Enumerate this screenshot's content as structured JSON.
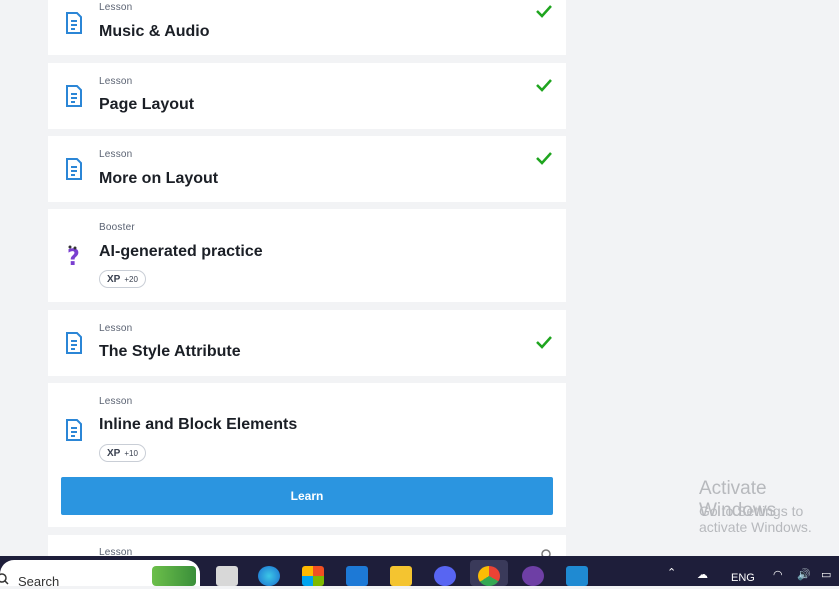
{
  "cards": [
    {
      "type": "Lesson",
      "title": "Music & Audio",
      "completed": true
    },
    {
      "type": "Lesson",
      "title": "Page Layout",
      "completed": true
    },
    {
      "type": "Lesson",
      "title": "More on Layout",
      "completed": true
    },
    {
      "type": "Booster",
      "title": "AI-generated practice",
      "xp_label": "XP",
      "xp_amount": "+20",
      "completed": false
    },
    {
      "type": "Lesson",
      "title": "The Style Attribute",
      "completed": true
    },
    {
      "type": "Lesson",
      "title": "Inline and Block Elements",
      "xp_label": "XP",
      "xp_amount": "+10",
      "button": "Learn",
      "completed": false
    },
    {
      "type": "Lesson",
      "title": "",
      "completed": false
    }
  ],
  "watermark": {
    "line1": "Activate Windows",
    "line2": "Go to Settings to activate Windows."
  },
  "taskbar": {
    "search_label": "Search",
    "tray_language": "ENG",
    "icons": [
      "task-view-icon",
      "edge-icon",
      "store-icon",
      "mail-icon",
      "file-explorer-icon",
      "discord-icon",
      "chrome-icon",
      "github-icon",
      "vscode-icon"
    ]
  },
  "colors": {
    "accent": "#2b95e0",
    "check": "#1fa51f",
    "lesson_icon": "#2b86d6",
    "booster_icon": "#7a3fd0",
    "taskbar": "#1e1e3a"
  }
}
